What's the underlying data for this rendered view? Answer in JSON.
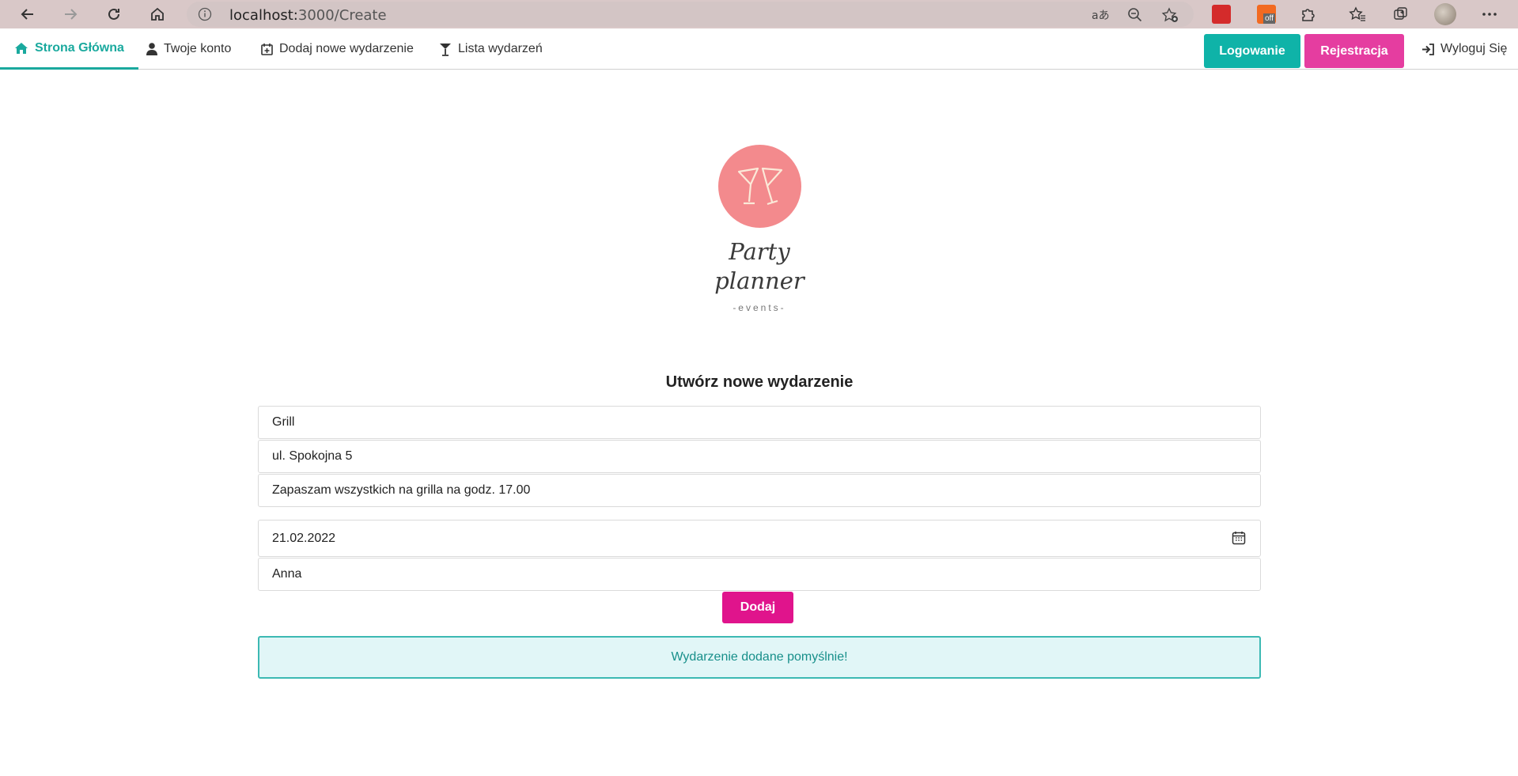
{
  "browser": {
    "url_host": "localhost:",
    "url_path": "3000/Create",
    "ext_badge": "off"
  },
  "navbar": {
    "home": "Strona Główna",
    "account": "Twoje konto",
    "add_event": "Dodaj nowe wydarzenie",
    "event_list": "Lista wydarzeń",
    "login": "Logowanie",
    "register": "Rejestracja",
    "logout": "Wyloguj Się"
  },
  "logo": {
    "line1": "Party",
    "line2": "planner",
    "sub": "-events-"
  },
  "form": {
    "title": "Utwórz nowe wydarzenie",
    "name": "Grill",
    "address": "ul. Spokojna 5",
    "description": "Zapaszam wszystkich na grilla na godz. 17.00",
    "date": "21.02.2022",
    "organizer": "Anna",
    "submit": "Dodaj"
  },
  "alert": {
    "message": "Wydarzenie dodane pomyślnie!"
  },
  "colors": {
    "teal": "#0fb3a8",
    "pink": "#e53da0",
    "logo_pink": "#f38a8d"
  }
}
